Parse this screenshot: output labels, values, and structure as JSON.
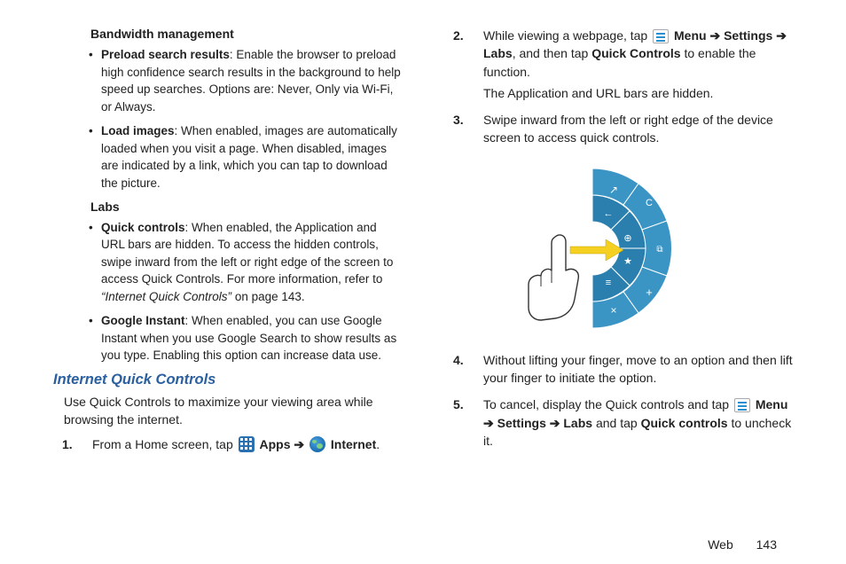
{
  "left": {
    "subhead1": "Bandwidth management",
    "b1_title": "Preload search results",
    "b1_text": ": Enable the browser to preload high confidence search results in the background to help speed up searches. Options are: Never, Only via Wi-Fi, or Always.",
    "b2_title": "Load images",
    "b2_text": ": When enabled, images are automatically loaded when you visit a page. When disabled, images are indicated by a link, which you can tap to download the picture.",
    "subhead2": "Labs",
    "b3_title": "Quick controls",
    "b3_text_a": ": When enabled, the Application and URL bars are hidden. To access the hidden controls, swipe inward from the left or right edge of the screen to access Quick Controls. For more information, refer to ",
    "b3_ref": "“Internet Quick Controls”",
    "b3_text_b": "  on page 143.",
    "b4_title": "Google Instant",
    "b4_text": ": When enabled, you can use Google Instant when you use Google Search to show results as you type. Enabling this option can increase data use.",
    "section_title": "Internet Quick Controls",
    "intro": "Use Quick Controls to maximize your viewing area while browsing the internet.",
    "step1_a": "From a Home screen, tap ",
    "step1_apps": " Apps ",
    "step1_arrow": "➔",
    "step1_internet": " Internet",
    "step1_dot": "."
  },
  "right": {
    "step2_a": "While viewing a webpage, tap ",
    "step2_menu": " Menu ",
    "step2_arrow1": "➔",
    "step2_settings": " Settings ",
    "step2_arrow2": "➔",
    "step2_labs": " Labs",
    "step2_b": ", and then tap ",
    "step2_qc": "Quick Controls",
    "step2_c": " to enable the function.",
    "step2_sub": "The Application and URL bars are hidden.",
    "step3": "Swipe inward from the left or right edge of the device screen to access quick controls.",
    "step4": "Without lifting your finger, move to an option and then lift your finger to initiate the option.",
    "step5_a": "To cancel, display the Quick controls and tap ",
    "step5_menu": " Menu ",
    "step5_arrow1": "➔",
    "step5_settings": " Settings ",
    "step5_arrow2": "➔",
    "step5_labs": " Labs",
    "step5_b": " and tap ",
    "step5_qc": "Quick controls",
    "step5_c": " to uncheck it."
  },
  "footer": {
    "section": "Web",
    "page": "143"
  },
  "nums": {
    "n1": "1.",
    "n2": "2.",
    "n3": "3.",
    "n4": "4.",
    "n5": "5."
  }
}
